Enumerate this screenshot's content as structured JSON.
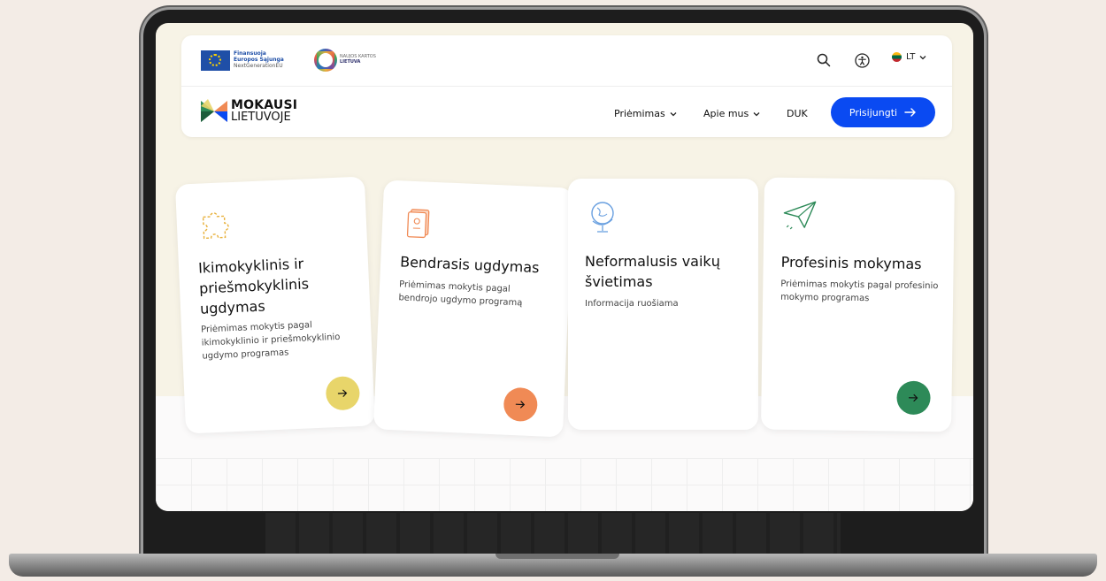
{
  "header": {
    "eu_line1": "Finansuoja",
    "eu_line2": "Europos Sąjunga",
    "eu_line3": "NextGenerationEU",
    "ngl_line1": "NAUJOS KARTOS",
    "ngl_line2": "LIETUVA",
    "lang_label": "LT",
    "logo_line1": "MOKAUSI",
    "logo_line2": "LIETUVOJE",
    "nav": {
      "admissions": "Priėmimas",
      "about": "Apie mus",
      "faq": "DUK"
    },
    "login_label": "Prisijungti"
  },
  "cards": [
    {
      "title": "Ikimokyklinis ir priešmokyklinis ugdymas",
      "subtitle": "Priėmimas mokytis pagal ikimokyklinio ir priešmokyklinio ugdymo programas",
      "icon": "puzzle-icon",
      "arrow_color": "#e8d56a"
    },
    {
      "title": "Bendrasis ugdymas",
      "subtitle": "Priėmimas mokytis pagal bendrojo ugdymo programą",
      "icon": "book-icon",
      "arrow_color": "#f08a55"
    },
    {
      "title": "Neformalusis vaikų švietimas",
      "subtitle": "Informacija ruošiama",
      "icon": "globe-icon"
    },
    {
      "title": "Profesinis mokymas",
      "subtitle": "Priėmimas mokytis pagal profesinio mokymo programas",
      "icon": "paper-plane-icon",
      "arrow_color": "#2d8a58"
    }
  ],
  "colors": {
    "primary": "#0a4af2",
    "background": "#f3ece6"
  }
}
